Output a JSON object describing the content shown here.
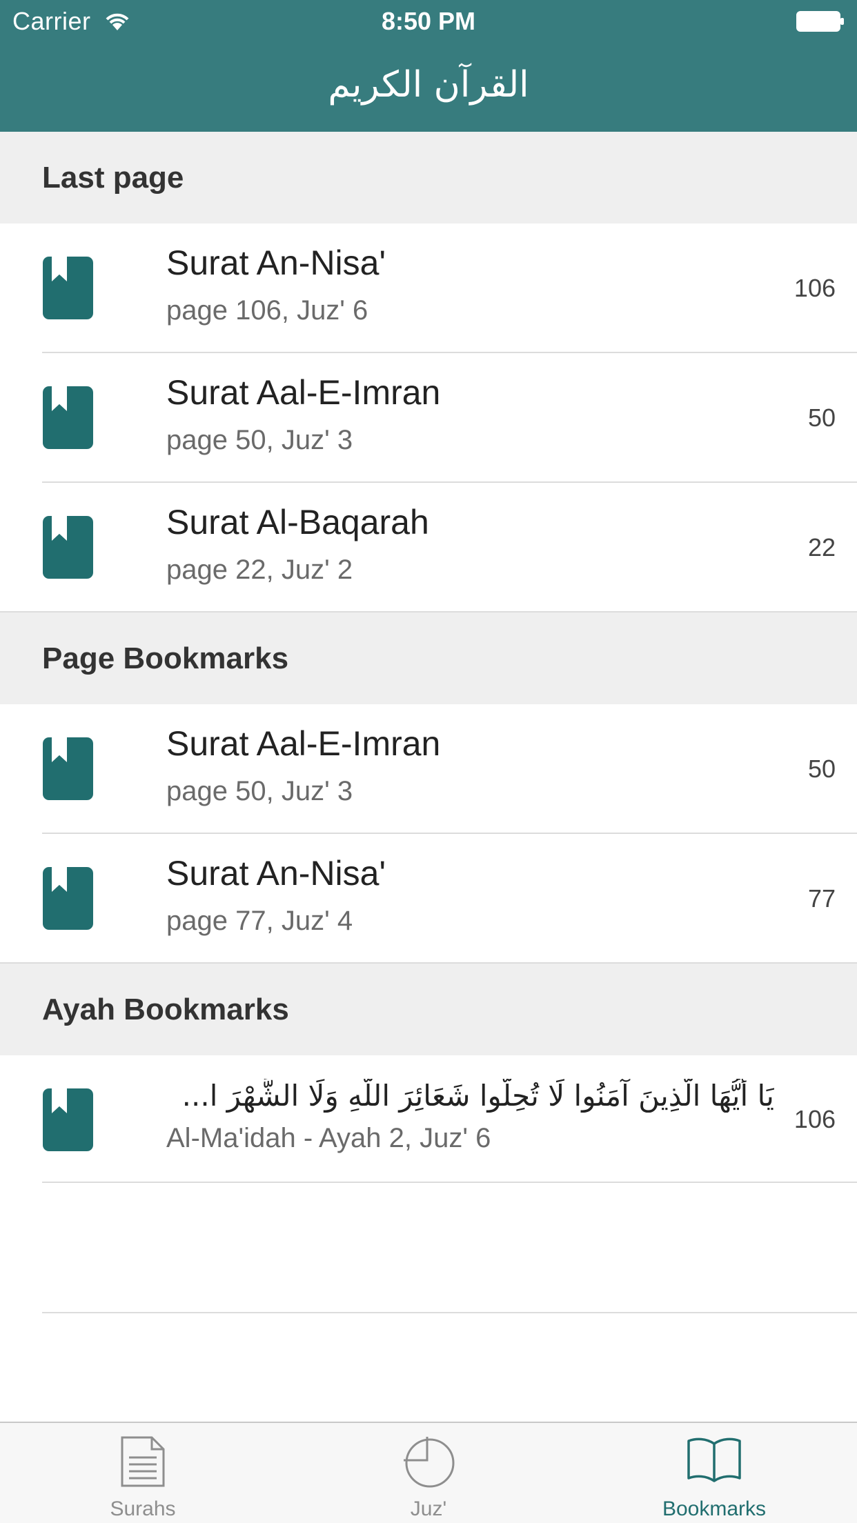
{
  "status_bar": {
    "carrier": "Carrier",
    "time": "8:50 PM"
  },
  "nav": {
    "title": "القرآن الكريم"
  },
  "sections": [
    {
      "title": "Last page",
      "rows": [
        {
          "title": "Surat An-Nisa'",
          "subtitle": "page 106, Juz' 6",
          "page": "106"
        },
        {
          "title": "Surat Aal-E-Imran",
          "subtitle": "page 50, Juz' 3",
          "page": "50"
        },
        {
          "title": "Surat Al-Baqarah",
          "subtitle": "page 22, Juz' 2",
          "page": "22"
        }
      ]
    },
    {
      "title": "Page Bookmarks",
      "rows": [
        {
          "title": "Surat Aal-E-Imran",
          "subtitle": "page 50, Juz' 3",
          "page": "50"
        },
        {
          "title": "Surat An-Nisa'",
          "subtitle": "page 77, Juz' 4",
          "page": "77"
        }
      ]
    },
    {
      "title": "Ayah Bookmarks",
      "rows": [
        {
          "title": "يَا أَيُّهَا الَّذِينَ آمَنُوا لَا تُحِلُّوا شَعَائِرَ اللَّهِ وَلَا الشَّهْرَ ا...",
          "subtitle": "Al-Ma'idah - Ayah 2, Juz' 6",
          "page": "106"
        }
      ]
    }
  ],
  "tabs": [
    {
      "label": "Surahs",
      "icon": "document-icon",
      "active": false
    },
    {
      "label": "Juz'",
      "icon": "pie-icon",
      "active": false
    },
    {
      "label": "Bookmarks",
      "icon": "open-book-icon",
      "active": true
    }
  ],
  "colors": {
    "accent": "#377c7e",
    "icon": "#216e6f",
    "section_bg": "#efefef",
    "tab_inactive": "#8e8e8e"
  }
}
